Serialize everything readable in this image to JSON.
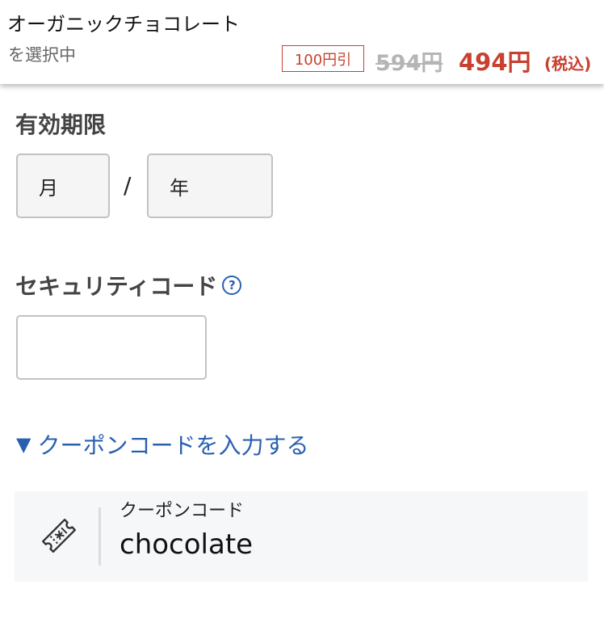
{
  "header": {
    "product_name": "オーガニックチョコレート",
    "selecting_text": "を選択中",
    "discount_badge": "100円引",
    "old_price": "594円",
    "new_price": "494円",
    "tax_note": "(税込)"
  },
  "expiry": {
    "label": "有効期限",
    "month_placeholder": "月",
    "separator": "/",
    "year_placeholder": "年"
  },
  "security_code": {
    "label": "セキュリティコード",
    "help_icon": "question-circle-icon",
    "help_glyph": "?",
    "value": ""
  },
  "coupon": {
    "toggle_icon": "▼",
    "toggle_label": "クーポンコードを入力する",
    "field_label": "クーポンコード",
    "field_value": "chocolate",
    "icon": "ticket-icon"
  },
  "colors": {
    "accent_red": "#c8402f",
    "link_blue": "#2a5fb0",
    "muted_gray": "#b5b5b5"
  }
}
